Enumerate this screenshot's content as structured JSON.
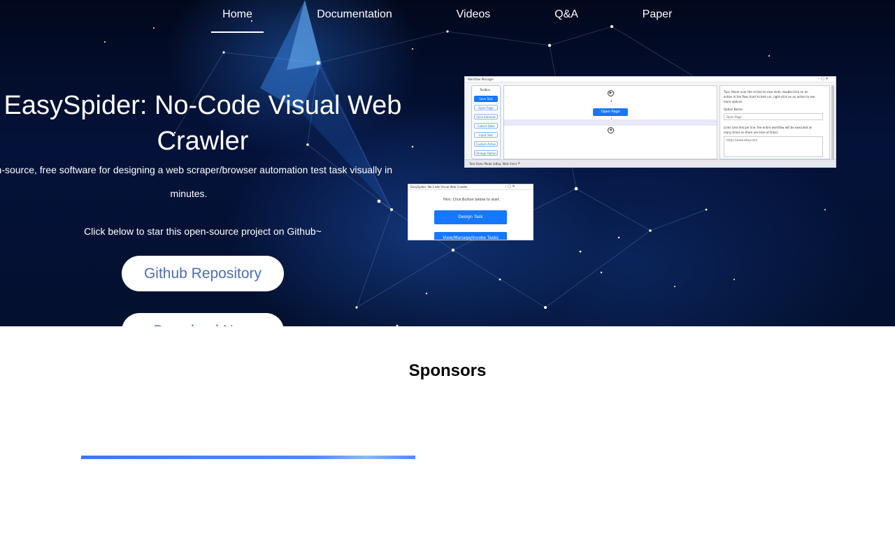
{
  "nav": {
    "items": [
      {
        "label": "Home",
        "active": true
      },
      {
        "label": "Documentation",
        "active": false
      },
      {
        "label": "Videos",
        "active": false
      },
      {
        "label": "Q&A",
        "active": false
      },
      {
        "label": "Paper",
        "active": false
      }
    ]
  },
  "hero": {
    "title": "EasySpider: No-Code Visual Web Crawler",
    "subtitle": "pen-source, free software for designing a web scraper/browser automation test task visually in minutes.",
    "star_text": "Click below to star this open-source project on Github~",
    "github_button": "Github Repository",
    "download_button": "Download Now"
  },
  "screenshot_main": {
    "window_title": "Workflow Manager",
    "toolbox_title": "Toolbox",
    "toolbox_items": [
      "Save Task",
      "Open Page",
      "Click Element",
      "Collect Data",
      "Input Text",
      "Custom Action",
      "Change Option"
    ],
    "flow_node": "Open Page",
    "tips_1": "Tips: Hover over the circles to view hints, double-click on an",
    "tips_2": "action in the flow chart to test run, right-click on an action to see",
    "tips_3": "more options.",
    "option_name_label": "Option Name:",
    "option_name_value": "Open Page",
    "links_1": "Links (one link per line, the entire workflow will be executed as",
    "links_2": "many times as there are lines of links):",
    "link_value": "https://www.ebay.com",
    "taskbar_tab": "Task Rows Mode (eBay: Web Unin)"
  },
  "screenshot_small": {
    "window_title": "EasySpider: No-Code Visual Web Crawler",
    "hint": "Hint: Click Button below to start.",
    "design_button": "Design Task",
    "view_button": "View/Manage/Invoke Tasks"
  },
  "sponsors": {
    "title": "Sponsors"
  },
  "colors": {
    "hero_bg": "#03102e",
    "button_text": "#4a6fb0",
    "sponsor_bar": "#3a7bea",
    "app_blue": "#1677ff"
  }
}
